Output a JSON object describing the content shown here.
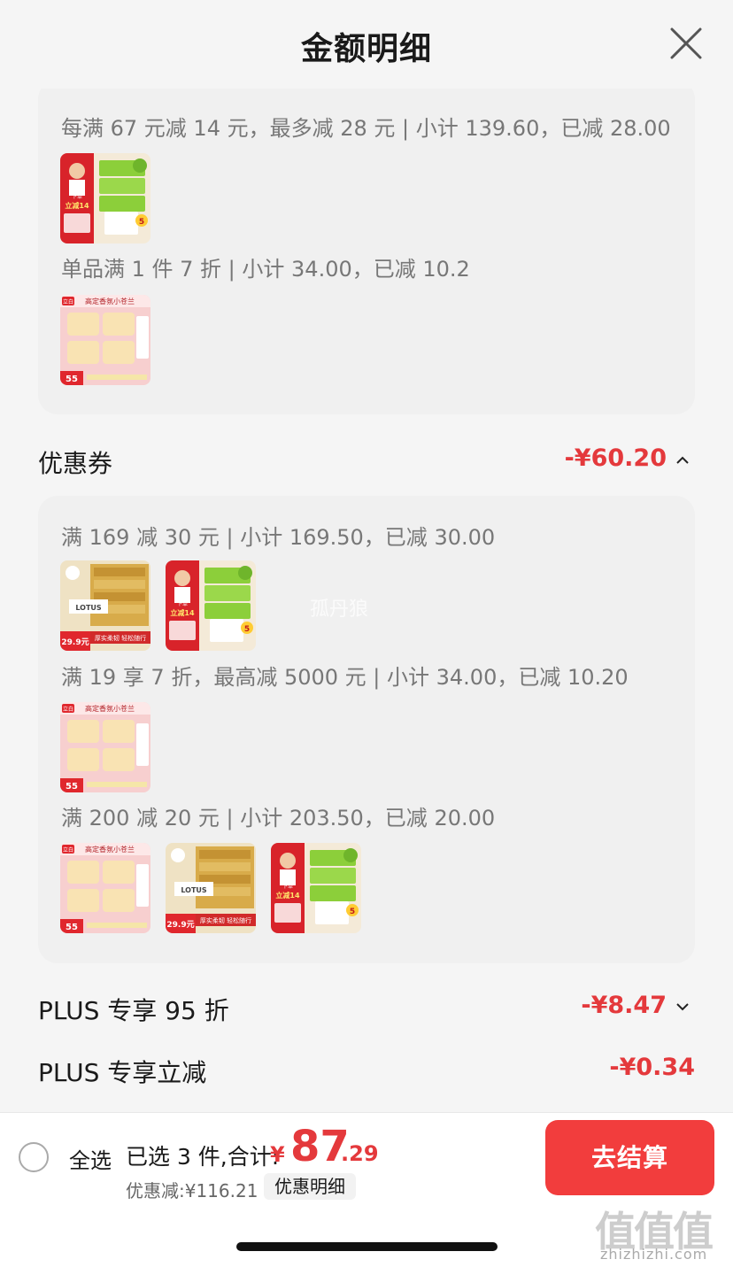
{
  "header": {
    "title": "金额明细"
  },
  "promo_card": {
    "rules": [
      {
        "text": "每满 67 元减 14 元，最多减 28 元 | 小计 139.60，已减 28.00"
      },
      {
        "text": "单品满 1 件 7 折 | 小计 34.00，已减 10.2"
      }
    ]
  },
  "coupon_section": {
    "label": "优惠券",
    "amount": "-¥60.20"
  },
  "coupon_card": {
    "rules": [
      {
        "text": "满 169 减 30 元 | 小计 169.50，已减 30.00"
      },
      {
        "text": "满 19 享 7 折，最高减 5000 元 | 小计 34.00，已减 10.20"
      },
      {
        "text": "满 200 减 20 元 | 小计 203.50，已减 20.00"
      }
    ],
    "watermark": "孤丹狼"
  },
  "plus_discount": {
    "label": "PLUS 专享 95 折",
    "amount": "-¥8.47"
  },
  "plus_instant": {
    "label": "PLUS 专享立减",
    "amount": "-¥0.34"
  },
  "products": {
    "green_tissue": {
      "badge_top": "下单",
      "badge_main": "立减14",
      "corner": "5"
    },
    "pink_wipes": {
      "brand": "立白",
      "title": "高定香氛小苍兰",
      "price": "55"
    },
    "gold_tissue": {
      "brand": "LOTUS",
      "price": "29.9元",
      "slogan": "厚实柔韧 轻松随行"
    }
  },
  "bottom_bar": {
    "select_all": "全选",
    "selected_text": "已选 3 件,合计:",
    "currency": "¥",
    "total_int": "87",
    "total_dec": ".29",
    "discount_text": "优惠减:¥116.21",
    "detail_button": "优惠明细",
    "checkout_button": "去结算"
  },
  "watermark_site": {
    "mark": "值值值",
    "url": "zhizhizhi.com"
  },
  "colors": {
    "accent_red": "#e4393c",
    "checkout_red": "#f23d3d",
    "background": "#f5f5f5",
    "card": "#f0f0f0"
  }
}
